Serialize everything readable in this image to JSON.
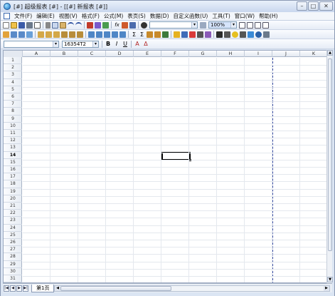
{
  "window": {
    "title": "[#] 超级报表 [#] - [[#] 新报表 [#]]",
    "controls": [
      "–",
      "□",
      "✕"
    ]
  },
  "menubar": {
    "items": [
      "文件(F)",
      "编辑(E)",
      "视图(V)",
      "格式(F)",
      "公式(M)",
      "表页(S)",
      "数据(D)",
      "自定义函数(U)",
      "工具(T)",
      "窗口(W)",
      "帮助(H)"
    ]
  },
  "toolbar1": {
    "combo_empty": "",
    "zoom": "100%"
  },
  "formatbar": {
    "font_family": "",
    "font_size": "16354T2",
    "bold": "B",
    "italic": "I",
    "underline": "U",
    "align_a": "A",
    "align_delta": "Δ"
  },
  "sheet": {
    "columns": [
      "A",
      "B",
      "C",
      "D",
      "E",
      "F",
      "G",
      "H",
      "I",
      "J",
      "K"
    ],
    "rows": [
      "1",
      "2",
      "3",
      "4",
      "5",
      "6",
      "7",
      "8",
      "9",
      "10",
      "11",
      "12",
      "13",
      "14",
      "15",
      "16",
      "17",
      "18",
      "19",
      "20",
      "21",
      "22",
      "23",
      "24",
      "25",
      "26",
      "27",
      "28",
      "29",
      "30",
      "31"
    ],
    "active_row": "14",
    "active_col": "F",
    "page_break_after_column": "I"
  },
  "tabs": {
    "nav": [
      "|◀",
      "◀",
      "▶",
      "▶|"
    ],
    "sheet_tab": "第1页"
  },
  "scroll": {
    "up": "▲",
    "down": "▼",
    "left": "◀",
    "right": "▶"
  },
  "colors": {
    "selection": "#000000",
    "page_break": "#3b4ea3",
    "frame": "#dbe5f3"
  }
}
